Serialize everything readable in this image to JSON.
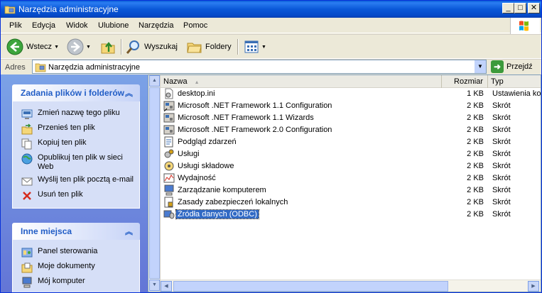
{
  "window": {
    "title": "Narzędzia administracyjne",
    "minimize": "_",
    "maximize": "□",
    "close": "✕"
  },
  "menu": [
    "Plik",
    "Edycja",
    "Widok",
    "Ulubione",
    "Narzędzia",
    "Pomoc"
  ],
  "toolbar": {
    "back": "Wstecz",
    "search": "Wyszukaj",
    "folders": "Foldery"
  },
  "address": {
    "label": "Adres",
    "value": "Narzędzia administracyjne",
    "go": "Przejdź"
  },
  "panels": {
    "tasks": {
      "title": "Zadania plików i folderów",
      "items": [
        {
          "label": "Zmień nazwę tego pliku",
          "icon": "rename-icon"
        },
        {
          "label": "Przenieś ten plik",
          "icon": "move-icon"
        },
        {
          "label": "Kopiuj ten plik",
          "icon": "copy-icon"
        },
        {
          "label": "Opublikuj ten plik w sieci Web",
          "icon": "publish-web-icon"
        },
        {
          "label": "Wyślij ten plik pocztą e-mail",
          "icon": "email-icon"
        },
        {
          "label": "Usuń ten plik",
          "icon": "delete-icon"
        }
      ]
    },
    "places": {
      "title": "Inne miejsca",
      "items": [
        {
          "label": "Panel sterowania",
          "icon": "control-panel-icon"
        },
        {
          "label": "Moje dokumenty",
          "icon": "my-documents-icon"
        },
        {
          "label": "Mój komputer",
          "icon": "my-computer-icon"
        }
      ]
    }
  },
  "columns": {
    "name": "Nazwa",
    "size": "Rozmiar",
    "type": "Typ"
  },
  "files": [
    {
      "name": "desktop.ini",
      "size": "1 KB",
      "type": "Ustawienia konfig",
      "icon": "ini-file-icon"
    },
    {
      "name": "Microsoft .NET Framework 1.1 Configuration",
      "size": "2 KB",
      "type": "Skrót",
      "icon": "net-config-icon"
    },
    {
      "name": "Microsoft .NET Framework 1.1 Wizards",
      "size": "2 KB",
      "type": "Skrót",
      "icon": "net-wizards-icon"
    },
    {
      "name": "Microsoft .NET Framework 2.0 Configuration",
      "size": "2 KB",
      "type": "Skrót",
      "icon": "net-config-icon"
    },
    {
      "name": "Podgląd zdarzeń",
      "size": "2 KB",
      "type": "Skrót",
      "icon": "event-viewer-icon"
    },
    {
      "name": "Usługi",
      "size": "2 KB",
      "type": "Skrót",
      "icon": "services-icon"
    },
    {
      "name": "Usługi składowe",
      "size": "2 KB",
      "type": "Skrót",
      "icon": "component-services-icon"
    },
    {
      "name": "Wydajność",
      "size": "2 KB",
      "type": "Skrót",
      "icon": "performance-icon"
    },
    {
      "name": "Zarządzanie komputerem",
      "size": "2 KB",
      "type": "Skrót",
      "icon": "computer-management-icon"
    },
    {
      "name": "Zasady zabezpieczeń lokalnych",
      "size": "2 KB",
      "type": "Skrót",
      "icon": "security-policy-icon"
    },
    {
      "name": "Źródła danych (ODBC)",
      "size": "2 KB",
      "type": "Skrót",
      "icon": "odbc-icon",
      "selected": true
    }
  ]
}
